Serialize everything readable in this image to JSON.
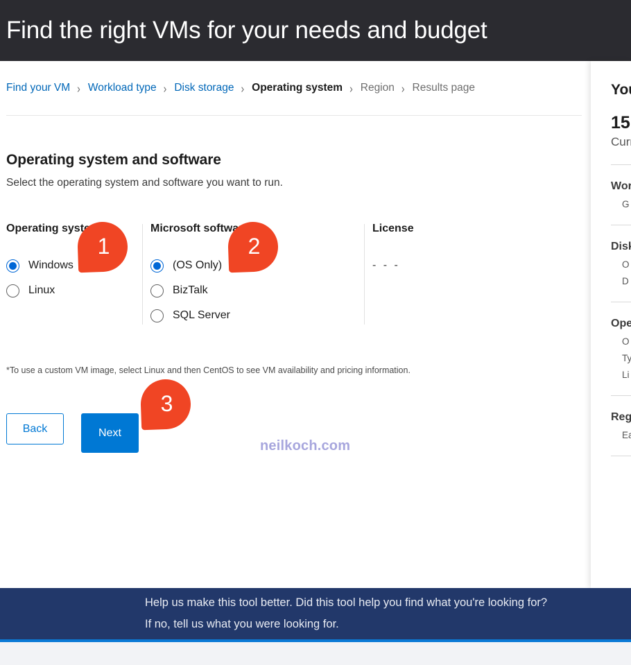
{
  "banner": {
    "title": "Find the right VMs for your needs and budget"
  },
  "breadcrumb": {
    "separator": "›",
    "items": [
      {
        "label": "Find your VM",
        "state": "link"
      },
      {
        "label": "Workload type",
        "state": "link"
      },
      {
        "label": "Disk storage",
        "state": "link"
      },
      {
        "label": "Operating system",
        "state": "current"
      },
      {
        "label": "Region",
        "state": "future"
      },
      {
        "label": "Results page",
        "state": "future"
      }
    ]
  },
  "main": {
    "section_title": "Operating system and software",
    "section_subtitle": "Select the operating system and software you want to run.",
    "columns": {
      "operating_system": {
        "header": "Operating system",
        "options": [
          {
            "label": "Windows",
            "selected": true
          },
          {
            "label": "Linux",
            "selected": false
          }
        ]
      },
      "microsoft_software": {
        "header": "Microsoft software",
        "options": [
          {
            "label": "(OS Only)",
            "selected": true
          },
          {
            "label": "BizTalk",
            "selected": false
          },
          {
            "label": "SQL Server",
            "selected": false
          }
        ]
      },
      "license": {
        "header": "License",
        "value": "- - -"
      }
    },
    "footnote": "*To use a custom VM image, select Linux and then CentOS to see VM availability and pricing information.",
    "buttons": {
      "back": "Back",
      "next": "Next"
    },
    "watermark": "neilkoch.com"
  },
  "callouts": [
    {
      "number": "1",
      "target": "operating-system-column"
    },
    {
      "number": "2",
      "target": "microsoft-software-column"
    },
    {
      "number": "3",
      "target": "next-button"
    }
  ],
  "side_panel": {
    "title": "Your",
    "count": "15",
    "count_subtitle": "Curr",
    "sections": [
      {
        "title": "Work",
        "items": [
          "G"
        ]
      },
      {
        "title": "Disk",
        "items": [
          "O",
          "D"
        ]
      },
      {
        "title": "Oper",
        "items": [
          "O",
          "Ty",
          "Li"
        ]
      },
      {
        "title": "Regi",
        "items": [
          "Ea"
        ]
      }
    ]
  },
  "footer": {
    "line1": "Help us make this tool better. Did this tool help you find what you're looking for?",
    "line2": "If no, tell us what you were looking for."
  },
  "colors": {
    "banner_bg": "#2b2b30",
    "accent_blue": "#0078d4",
    "link_blue": "#0067b8",
    "callout_orange": "#f04524",
    "footer_navy": "#22386a",
    "footer_accent": "#0b7ad6",
    "watermark": "#a7a6dd"
  }
}
